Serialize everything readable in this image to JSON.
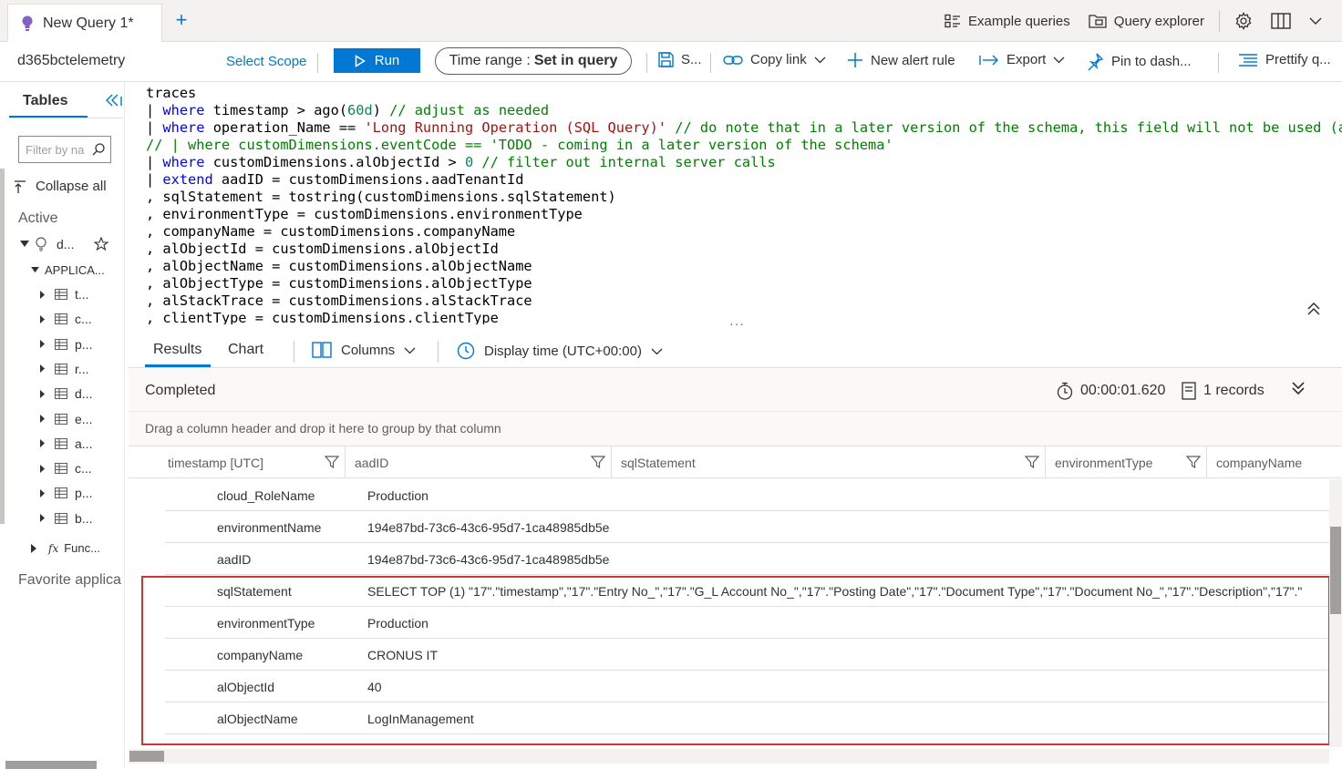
{
  "tab": {
    "title": "New Query 1*",
    "add": "+"
  },
  "topbar": {
    "example_queries": "Example queries",
    "query_explorer": "Query explorer"
  },
  "toolbar": {
    "workspace": "d365bctelemetry",
    "select_scope": "Select Scope",
    "run": "Run",
    "time_range_label": "Time range :",
    "time_range_value": "Set in query",
    "save": "S...",
    "copy_link": "Copy link",
    "new_alert_rule": "New alert rule",
    "export": "Export",
    "pin": "Pin to dash...",
    "prettify": "Prettify q..."
  },
  "left": {
    "tables_tab": "Tables",
    "filter_placeholder": "Filter by na",
    "collapse_all": "Collapse all",
    "active": "Active",
    "workspace_item": "d...",
    "applications": "APPLICA...",
    "tables": [
      "t...",
      "c...",
      "p...",
      "r...",
      "d...",
      "e...",
      "a...",
      "c...",
      "p...",
      "b..."
    ],
    "functions": "Func...",
    "favorite": "Favorite applica"
  },
  "query_lines": [
    [
      [
        "fn",
        "traces"
      ]
    ],
    [
      [
        "op",
        "| "
      ],
      [
        "kw",
        "where"
      ],
      [
        "fn",
        " timestamp > ago("
      ],
      [
        "nm",
        "60d"
      ],
      [
        "fn",
        ") "
      ],
      [
        "cm",
        "// adjust as needed"
      ]
    ],
    [
      [
        "op",
        "| "
      ],
      [
        "kw",
        "where"
      ],
      [
        "fn",
        " operation_Name == "
      ],
      [
        "st",
        "'Long Running Operation (SQL Query)'"
      ],
      [
        "fn",
        " "
      ],
      [
        "cm",
        "// do note that in a later version of the schema, this field will not be used (a"
      ]
    ],
    [
      [
        "cm",
        "// | where customDimensions.eventCode == 'TODO - coming in a later version of the schema'"
      ]
    ],
    [
      [
        "op",
        "| "
      ],
      [
        "kw",
        "where"
      ],
      [
        "fn",
        " customDimensions.alObjectId > "
      ],
      [
        "nm",
        "0"
      ],
      [
        "fn",
        " "
      ],
      [
        "cm",
        "// filter out internal server calls"
      ]
    ],
    [
      [
        "op",
        "| "
      ],
      [
        "kw",
        "extend"
      ],
      [
        "fn",
        " aadID = customDimensions.aadTenantId"
      ]
    ],
    [
      [
        "fn",
        ", sqlStatement = tostring(customDimensions.sqlStatement)"
      ]
    ],
    [
      [
        "fn",
        ", environmentType = customDimensions.environmentType"
      ]
    ],
    [
      [
        "fn",
        ", companyName = customDimensions.companyName"
      ]
    ],
    [
      [
        "fn",
        ", alObjectId = customDimensions.alObjectId"
      ]
    ],
    [
      [
        "fn",
        ", alObjectName = customDimensions.alObjectName"
      ]
    ],
    [
      [
        "fn",
        ", alObjectType = customDimensions.alObjectType"
      ]
    ],
    [
      [
        "fn",
        ", alStackTrace = customDimensions.alStackTrace"
      ]
    ],
    [
      [
        "fn",
        ", clientType = customDimensions.clientType"
      ]
    ]
  ],
  "results": {
    "tab_results": "Results",
    "tab_chart": "Chart",
    "columns": "Columns",
    "display_time": "Display time (UTC+00:00)",
    "status": "Completed",
    "duration": "00:00:01.620",
    "records": "1 records",
    "group_hint": "Drag a column header and drop it here to group by that column",
    "headers": [
      "timestamp [UTC]",
      "aadID",
      "sqlStatement",
      "environmentType",
      "companyName"
    ],
    "detail_rows": [
      {
        "key": "cloud_RoleName",
        "value": "Production"
      },
      {
        "key": "environmentName",
        "value": "194e87bd-73c6-43c6-95d7-1ca48985db5e"
      },
      {
        "key": "aadID",
        "value": "194e87bd-73c6-43c6-95d7-1ca48985db5e"
      },
      {
        "key": "sqlStatement",
        "value": "SELECT  TOP (1) \"17\".\"timestamp\",\"17\".\"Entry No_\",\"17\".\"G_L Account No_\",\"17\".\"Posting Date\",\"17\".\"Document Type\",\"17\".\"Document No_\",\"17\".\"Description\",\"17\".\""
      },
      {
        "key": "environmentType",
        "value": "Production"
      },
      {
        "key": "companyName",
        "value": "CRONUS IT"
      },
      {
        "key": "alObjectId",
        "value": "40"
      },
      {
        "key": "alObjectName",
        "value": "LogInManagement"
      }
    ]
  },
  "colors": {
    "accent": "#0078d4",
    "highlight": "#d13438"
  }
}
